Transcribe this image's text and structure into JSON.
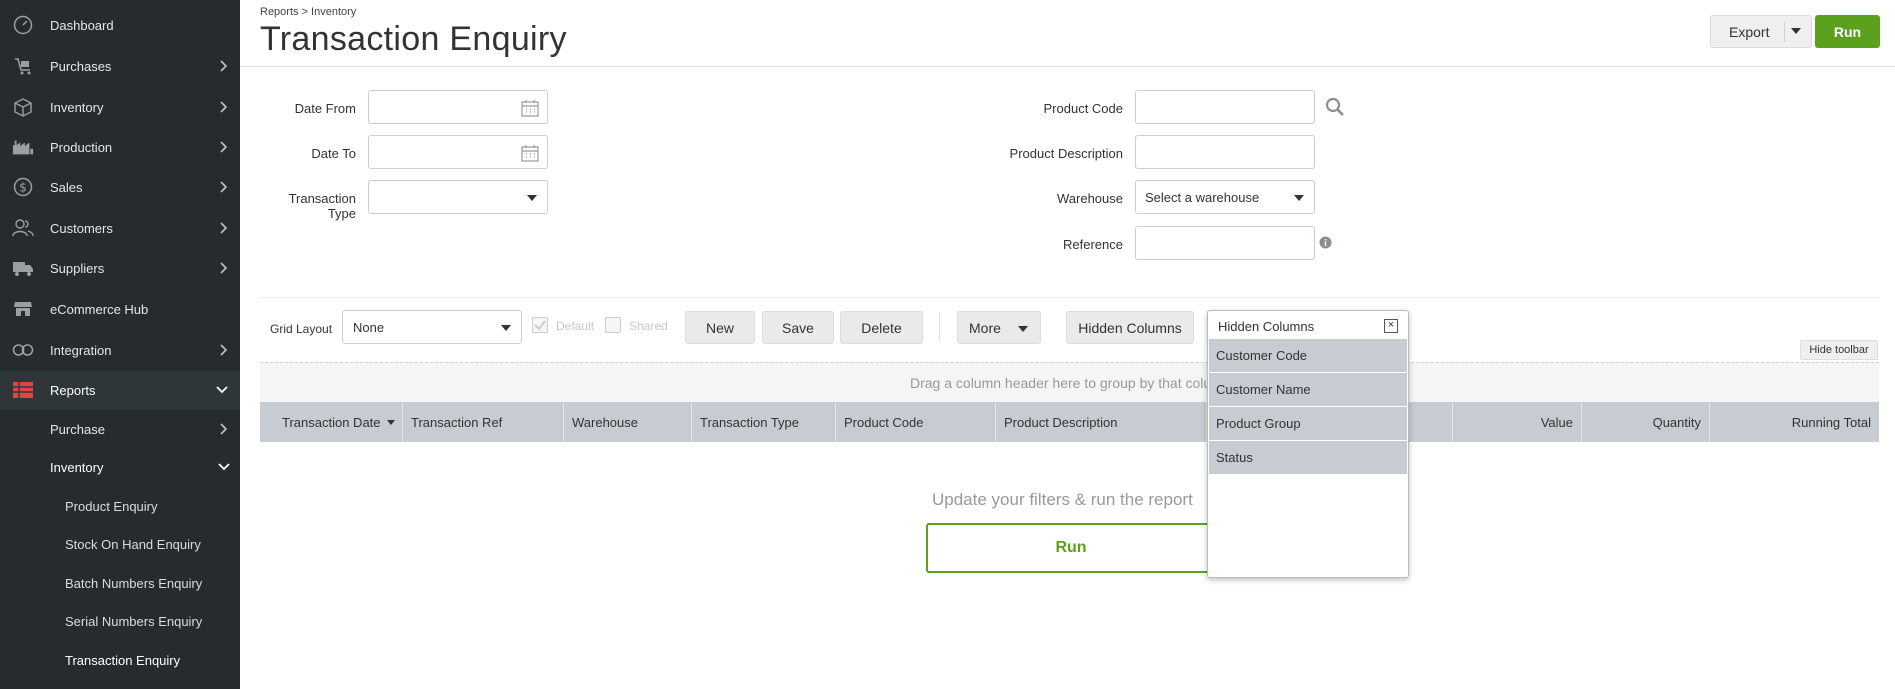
{
  "sidebar": {
    "items": [
      {
        "label": "Dashboard",
        "icon": "gauge-icon",
        "has_chevron": false
      },
      {
        "label": "Purchases",
        "icon": "cart-icon",
        "has_chevron": true
      },
      {
        "label": "Inventory",
        "icon": "box-icon",
        "has_chevron": true
      },
      {
        "label": "Production",
        "icon": "factory-icon",
        "has_chevron": true
      },
      {
        "label": "Sales",
        "icon": "dollar-icon",
        "has_chevron": true
      },
      {
        "label": "Customers",
        "icon": "users-icon",
        "has_chevron": true
      },
      {
        "label": "Suppliers",
        "icon": "truck-icon",
        "has_chevron": true
      },
      {
        "label": "eCommerce Hub",
        "icon": "store-icon",
        "has_chevron": false
      },
      {
        "label": "Integration",
        "icon": "link-icon",
        "has_chevron": true
      },
      {
        "label": "Reports",
        "icon": "table-icon",
        "has_chevron": true
      }
    ],
    "reports_sub": [
      {
        "label": "Purchase"
      },
      {
        "label": "Inventory"
      }
    ],
    "inventory_sub": [
      {
        "label": "Product Enquiry"
      },
      {
        "label": "Stock On Hand Enquiry"
      },
      {
        "label": "Batch Numbers Enquiry"
      },
      {
        "label": "Serial Numbers Enquiry"
      },
      {
        "label": "Transaction Enquiry"
      }
    ],
    "accent_color": "#e04545"
  },
  "header": {
    "breadcrumb": "Reports > Inventory",
    "title": "Transaction Enquiry",
    "export_label": "Export",
    "run_label": "Run"
  },
  "filters": {
    "date_from_label": "Date From",
    "date_to_label": "Date To",
    "transaction_type_label": "Transaction Type",
    "product_code_label": "Product Code",
    "product_description_label": "Product Description",
    "warehouse_label": "Warehouse",
    "warehouse_value": "Select a warehouse",
    "reference_label": "Reference"
  },
  "toolbar": {
    "grid_layout_label": "Grid Layout",
    "grid_layout_value": "None",
    "default_label": "Default",
    "shared_label": "Shared",
    "new_label": "New",
    "save_label": "Save",
    "delete_label": "Delete",
    "more_label": "More",
    "hidden_columns_label": "Hidden Columns",
    "hide_toolbar_label": "Hide toolbar"
  },
  "grid": {
    "group_hint": "Drag a column header here to group by that column",
    "columns": [
      {
        "label": "Transaction Date"
      },
      {
        "label": "Transaction Ref"
      },
      {
        "label": "Warehouse"
      },
      {
        "label": "Transaction Type"
      },
      {
        "label": "Product Code"
      },
      {
        "label": "Product Description"
      },
      {
        "label": ""
      },
      {
        "label": "Value"
      },
      {
        "label": "Quantity"
      },
      {
        "label": "Running Total"
      }
    ],
    "empty_message": "Update your filters & run the report",
    "run_label": "Run"
  },
  "hidden_columns_popup": {
    "title": "Hidden Columns",
    "close_glyph": "×",
    "items": [
      "Customer Code",
      "Customer Name",
      "Product Group",
      "Status"
    ]
  },
  "colors": {
    "sidebar_bg": "#262c2d",
    "primary_green": "#5ba11e",
    "header_row": "#c6ccd1"
  }
}
